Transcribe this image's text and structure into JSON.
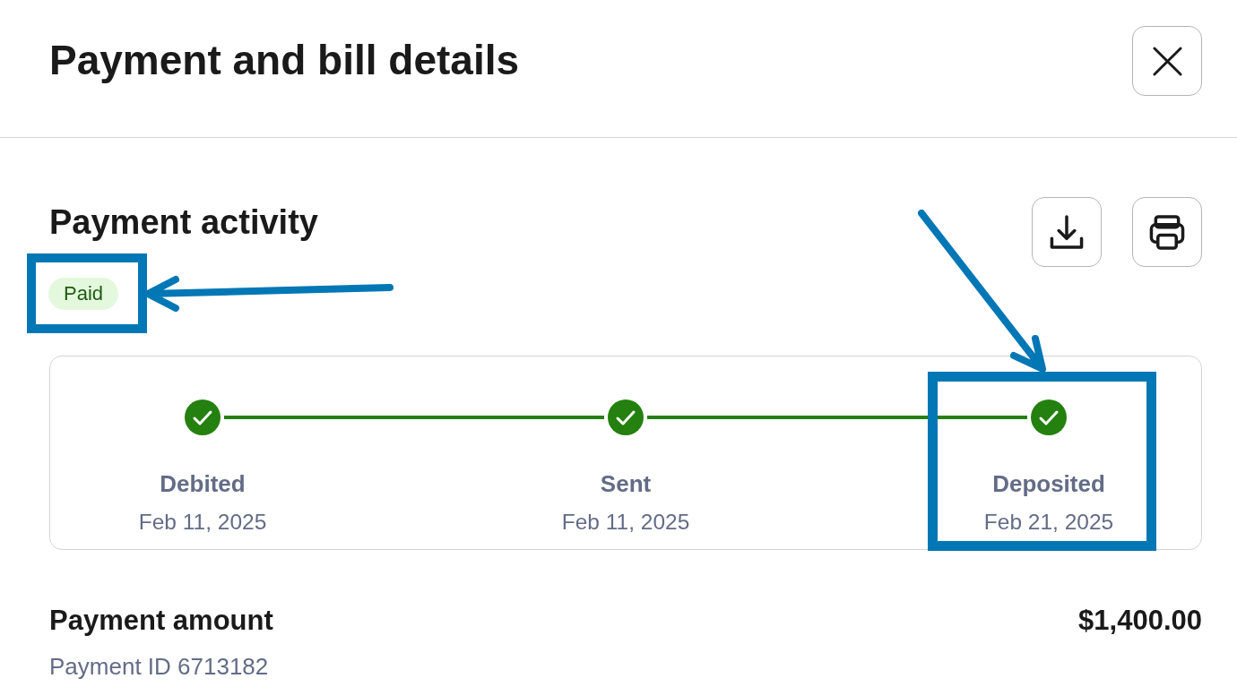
{
  "header": {
    "title": "Payment and bill details"
  },
  "activity": {
    "title": "Payment activity",
    "status": {
      "label": "Paid",
      "highlighted": true
    }
  },
  "timeline": {
    "steps": [
      {
        "label": "Debited",
        "date": "Feb 11, 2025",
        "done": true,
        "highlighted": false
      },
      {
        "label": "Sent",
        "date": "Feb 11, 2025",
        "done": true,
        "highlighted": false
      },
      {
        "label": "Deposited",
        "date": "Feb 21, 2025",
        "done": true,
        "highlighted": true
      }
    ]
  },
  "payment": {
    "label": "Payment amount",
    "amount": "$1,400.00",
    "id": "Payment ID 6713182"
  }
}
